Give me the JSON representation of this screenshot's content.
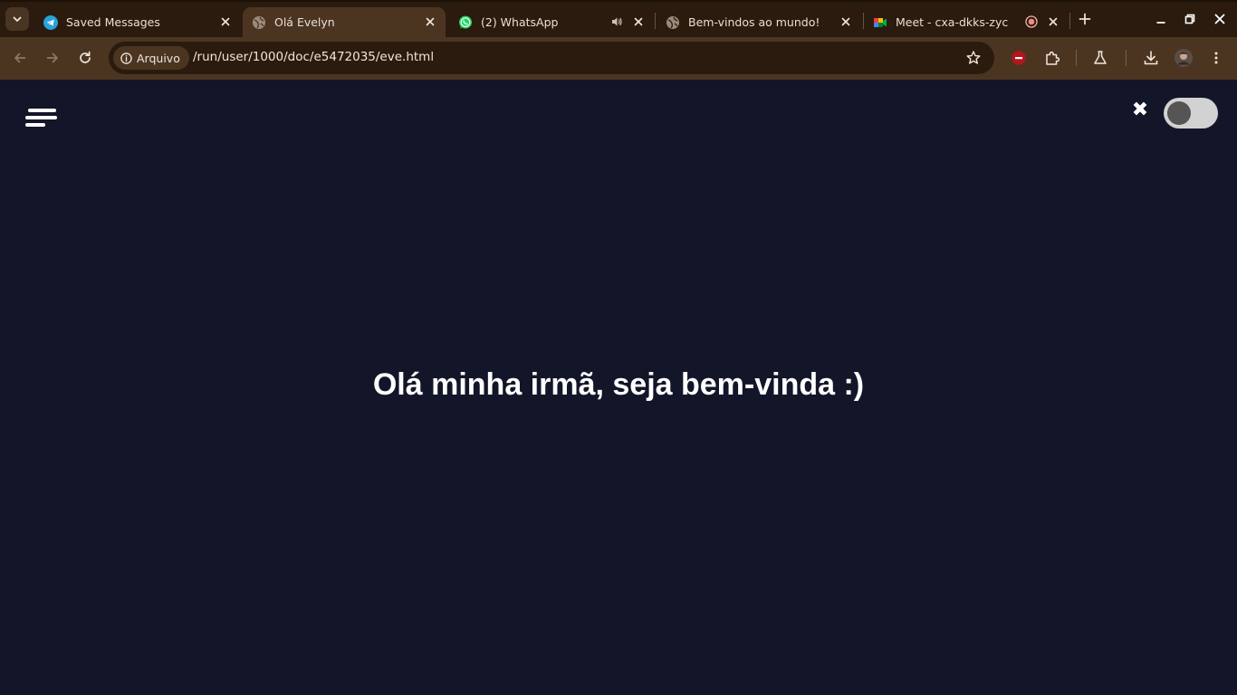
{
  "browser": {
    "tabs": [
      {
        "title": "Saved Messages",
        "icon": "telegram-icon",
        "active": false
      },
      {
        "title": "Olá Evelyn",
        "icon": "globe-icon",
        "active": true
      },
      {
        "title": "(2) WhatsApp",
        "icon": "whatsapp-icon",
        "active": false,
        "audio": true
      },
      {
        "title": "Bem-vindos ao mundo!",
        "icon": "globe-icon",
        "active": false
      },
      {
        "title": "Meet - cxa-dkks-zyc",
        "icon": "google-meet-icon",
        "active": false,
        "recording": true
      }
    ],
    "omnibox": {
      "site_chip_label": "Arquivo",
      "url": "/run/user/1000/doc/e5472035/eve.html"
    }
  },
  "page": {
    "greeting": "Olá minha irmã, seja bem-vinda :)",
    "close_symbol": "✖",
    "toggle_on": false
  },
  "colors": {
    "page_background": "#131629",
    "tabstrip": "#2a1b0e",
    "toolbar": "#4b3521",
    "text": "#ffffff"
  }
}
